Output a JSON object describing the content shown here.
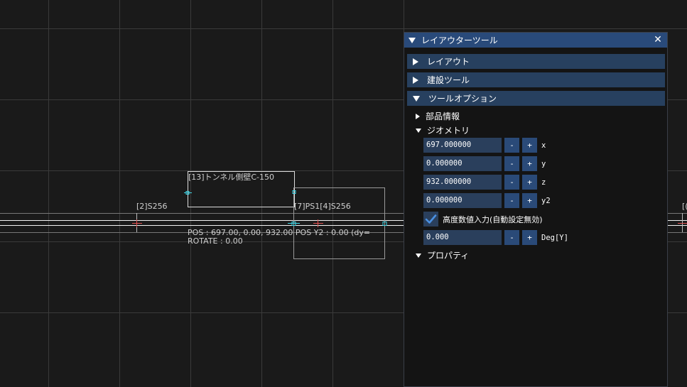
{
  "canvas": {
    "labels": {
      "track_left": "[2]S256",
      "tunnel": "[13]トンネル側壁C-150",
      "track_mid": "[7]PS1[4]S256",
      "pos_readout": "POS :  697.00,    0.00,  932.00  POS Y2 :     0.00 (dy=",
      "rotate_readout": "ROTATE : 0.00",
      "right_edge": "[("
    }
  },
  "panel": {
    "title": "レイアウターツール",
    "close_icon": "close-icon",
    "sections": {
      "layout": "レイアウト",
      "build_tools": "建設ツール",
      "tool_options": "ツールオプション"
    },
    "tree": {
      "parts_info": "部品情報",
      "geometry": "ジオメトリ",
      "properties": "プロパティ"
    },
    "geometry": {
      "fields": [
        {
          "value": "697.000000",
          "axis": "x"
        },
        {
          "value": "0.000000",
          "axis": "y"
        },
        {
          "value": "932.000000",
          "axis": "z"
        },
        {
          "value": "0.000000",
          "axis": "y2"
        }
      ],
      "minus_label": "-",
      "plus_label": "+",
      "height_input_label": "高度数値入力(自動設定無効)",
      "height_input_checked": true,
      "rotation": {
        "value": "0.000",
        "axis": "Deg[Y]"
      }
    }
  },
  "colors": {
    "background": "#1a1a1a",
    "grid": "#3a3a3a",
    "title_bar": "#294a7a",
    "section_header": "#27405f",
    "field": "#2a3f5c",
    "button": "#2a4a78",
    "accent_check": "#4a90e2",
    "marker_cyan": "#3fd6e6",
    "marker_red": "#e05050"
  }
}
